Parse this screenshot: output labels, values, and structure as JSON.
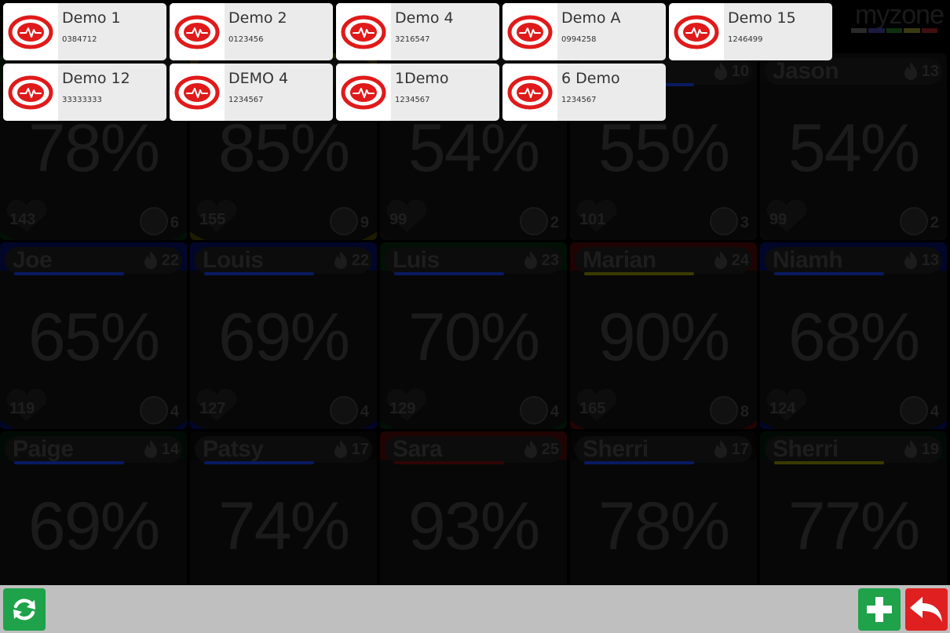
{
  "logo": {
    "text": "myzone",
    "bar_colors": [
      "#2a2a2a",
      "#1a1a40",
      "#0e3010",
      "#3a3a10",
      "#401010"
    ]
  },
  "tiles": [
    {
      "name": "",
      "mep": "",
      "pct": "78%",
      "hr": "143",
      "rank": "6",
      "bg": "#031006",
      "stripe": ""
    },
    {
      "name": "",
      "mep": "",
      "pct": "85%",
      "hr": "155",
      "rank": "9",
      "bg": "#1d1b00",
      "stripe": ""
    },
    {
      "name": "",
      "mep": "",
      "pct": "54%",
      "hr": "99",
      "rank": "2",
      "bg": "#080808",
      "stripe": ""
    },
    {
      "name": "",
      "mep": "10",
      "pct": "55%",
      "hr": "101",
      "rank": "3",
      "bg": "#080808",
      "stripe": "#0a1a60"
    },
    {
      "name": "Jason",
      "mep": "13",
      "pct": "54%",
      "hr": "99",
      "rank": "2",
      "bg": "#080808",
      "stripe": ""
    },
    {
      "name": "Joe",
      "mep": "22",
      "pct": "65%",
      "hr": "119",
      "rank": "4",
      "bg": "#020629",
      "stripe": "#0a1a60"
    },
    {
      "name": "Louis",
      "mep": "22",
      "pct": "69%",
      "hr": "127",
      "rank": "4",
      "bg": "#020629",
      "stripe": "#0a1a60"
    },
    {
      "name": "Luis",
      "mep": "23",
      "pct": "70%",
      "hr": "129",
      "rank": "4",
      "bg": "#031006",
      "stripe": "#0a1a60"
    },
    {
      "name": "Marian",
      "mep": "24",
      "pct": "90%",
      "hr": "165",
      "rank": "8",
      "bg": "#200303",
      "stripe": "#3a3a00"
    },
    {
      "name": "Niamh",
      "mep": "13",
      "pct": "68%",
      "hr": "124",
      "rank": "4",
      "bg": "#020629",
      "stripe": "#0a1a60"
    },
    {
      "name": "Paige",
      "mep": "14",
      "pct": "69%",
      "hr": "",
      "rank": "",
      "bg": "#020a05",
      "stripe": "#0a1a60"
    },
    {
      "name": "Patsy",
      "mep": "17",
      "pct": "74%",
      "hr": "",
      "rank": "",
      "bg": "#040404",
      "stripe": "#0a1a60"
    },
    {
      "name": "Sara",
      "mep": "25",
      "pct": "93%",
      "hr": "",
      "rank": "",
      "bg": "#200303",
      "stripe": "#300505"
    },
    {
      "name": "Sherri",
      "mep": "17",
      "pct": "78%",
      "hr": "",
      "rank": "",
      "bg": "#040404",
      "stripe": "#0a1a60"
    },
    {
      "name": "Sherri",
      "mep": "19",
      "pct": "77%",
      "hr": "",
      "rank": "",
      "bg": "#020a05",
      "stripe": "#3a3a00"
    }
  ],
  "cards": [
    {
      "name": "Demo 1",
      "id": "0384712"
    },
    {
      "name": "Demo 2",
      "id": "0123456"
    },
    {
      "name": "Demo 4",
      "id": "3216547"
    },
    {
      "name": "Demo A",
      "id": "0994258"
    },
    {
      "name": "Demo 15",
      "id": "1246499"
    },
    {
      "name": "Demo 12",
      "id": "33333333"
    },
    {
      "name": "DEMO 4",
      "id": "1234567"
    },
    {
      "name": "1Demo",
      "id": "1234567"
    },
    {
      "name": "6 Demo",
      "id": "1234567"
    }
  ],
  "buttons": {
    "refresh_icon": "refresh-icon",
    "add_icon": "plus-icon",
    "back_icon": "back-arrow-icon"
  },
  "colors": {
    "accent_green": "#1fa24a",
    "accent_red": "#e02020",
    "card_icon_red": "#e01a1a"
  }
}
